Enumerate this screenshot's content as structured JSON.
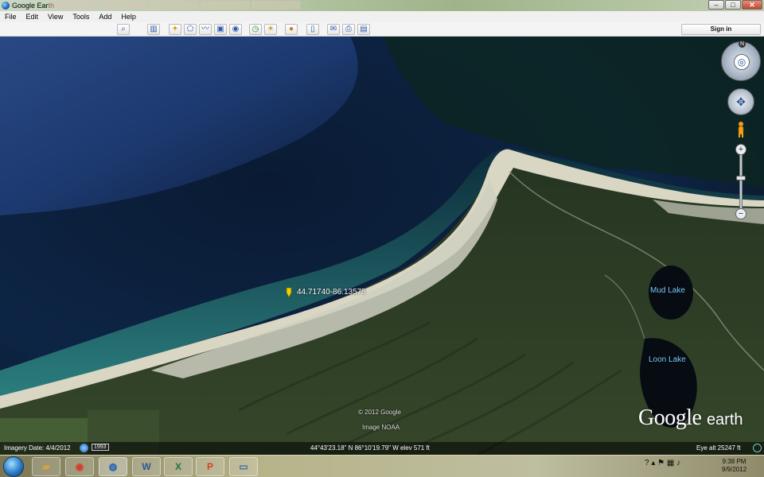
{
  "window": {
    "title": "Google Earth",
    "controls": {
      "minimize": "–",
      "maximize": "□",
      "close": "✕"
    }
  },
  "menu": [
    "File",
    "Edit",
    "View",
    "Tools",
    "Add",
    "Help"
  ],
  "toolbar": {
    "buttons": [
      "search-icon",
      "sidebar-icon",
      "placemark-icon",
      "polygon-icon",
      "path-icon",
      "image-overlay-icon",
      "record-tour-icon",
      "historical-imagery-icon",
      "sunlight-icon",
      "planets-icon",
      "ruler-icon",
      "email-icon",
      "print-icon",
      "save-image-icon"
    ],
    "signin_label": "Sign in"
  },
  "map": {
    "placemark_label": "44.71740-86.13575",
    "lakes": [
      {
        "name": "Mud Lake"
      },
      {
        "name": "Loon Lake"
      }
    ],
    "copyright": "© 2012 Google",
    "image_source": "Image NOAA",
    "logo_google": "Google",
    "logo_earth": "earth",
    "nav_north": "N"
  },
  "status": {
    "imagery_date": "Imagery Date: 4/4/2012",
    "year": "1993",
    "position": "44°43'23.18\" N   86°10'19.79\" W  elev   571 ft",
    "eye_alt": "Eye alt   25247 ft"
  },
  "taskbar": {
    "apps": [
      "explorer",
      "chrome",
      "google-earth",
      "word",
      "excel",
      "powerpoint",
      "window"
    ],
    "clock_time": "9:38 PM",
    "clock_date": "9/9/2012"
  },
  "colors": {
    "deep_water": "#0f2a52",
    "shallow_water": "#2f8a86",
    "sand": "#d9d6c4",
    "forest": "#2e3f22",
    "lake_label": "#7fc8ff"
  }
}
